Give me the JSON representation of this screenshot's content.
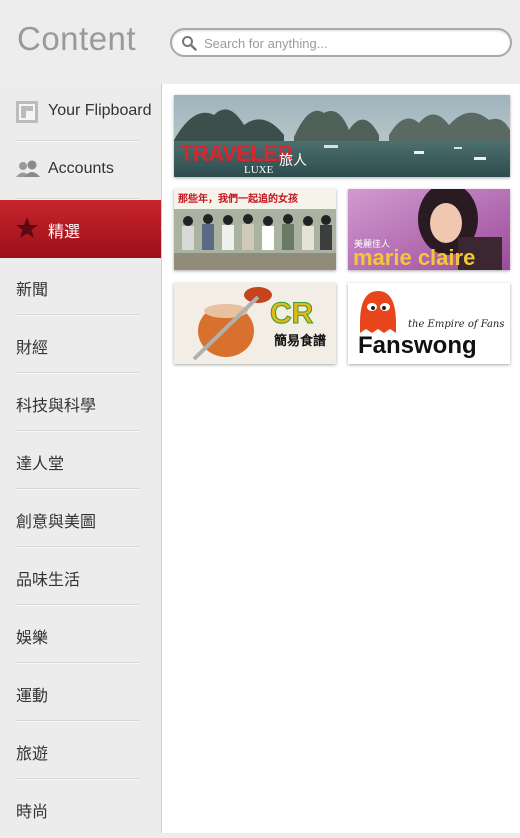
{
  "header": {
    "title": "Content",
    "search_placeholder": "Search for anything..."
  },
  "sidebar": {
    "items": [
      {
        "label": "Your Flipboard",
        "icon": "flipboard-icon"
      },
      {
        "label": "Accounts",
        "icon": "accounts-icon"
      },
      {
        "label": "精選",
        "icon": "star-icon",
        "active": true
      },
      {
        "label": "新聞"
      },
      {
        "label": "財經"
      },
      {
        "label": "科技與科學"
      },
      {
        "label": "達人堂"
      },
      {
        "label": "創意與美圖"
      },
      {
        "label": "品味生活"
      },
      {
        "label": "娛樂"
      },
      {
        "label": "運動"
      },
      {
        "label": "旅遊"
      },
      {
        "label": "時尚"
      }
    ]
  },
  "tiles": {
    "traveler": {
      "brand": "TRAVELER",
      "sub": "LUXE",
      "cjk": "旅人"
    },
    "movie": {
      "caption": "那些年，我們一起追的女孩"
    },
    "marieclaire": {
      "brand": "marie claire",
      "cjk": "美麗佳人"
    },
    "cr": {
      "brand": "CR",
      "cjk": "簡易食譜"
    },
    "fanswong": {
      "tagline": "the Empire of Fans",
      "brand": "Fanswong"
    }
  },
  "colors": {
    "accent": "#b81a23",
    "background": "#ececec"
  }
}
